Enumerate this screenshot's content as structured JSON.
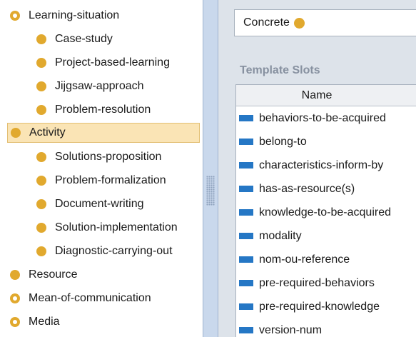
{
  "class_tree": {
    "items": [
      {
        "label": "Learning-situation",
        "level": 0,
        "icon": "ring-dot-icon"
      },
      {
        "label": "Case-study",
        "level": 1,
        "icon": "dot-icon"
      },
      {
        "label": "Project-based-learning",
        "level": 1,
        "icon": "dot-icon"
      },
      {
        "label": "Jijgsaw-approach",
        "level": 1,
        "icon": "dot-icon"
      },
      {
        "label": "Problem-resolution",
        "level": 1,
        "icon": "dot-icon"
      },
      {
        "label": "Activity",
        "level": 0,
        "icon": "dot-icon",
        "selected": true
      },
      {
        "label": "Solutions-proposition",
        "level": 1,
        "icon": "dot-icon"
      },
      {
        "label": "Problem-formalization",
        "level": 1,
        "icon": "dot-icon"
      },
      {
        "label": "Document-writing",
        "level": 1,
        "icon": "dot-icon"
      },
      {
        "label": "Solution-implementation",
        "level": 1,
        "icon": "dot-icon"
      },
      {
        "label": "Diagnostic-carrying-out",
        "level": 1,
        "icon": "dot-icon"
      },
      {
        "label": "Resource",
        "level": 0,
        "icon": "dot-icon"
      },
      {
        "label": "Mean-of-communication",
        "level": 0,
        "icon": "ring-dot-icon"
      },
      {
        "label": "Media",
        "level": 0,
        "icon": "ring-dot-icon"
      }
    ]
  },
  "class_field": {
    "value": "Concrete",
    "icon": "dot-icon"
  },
  "template_slots": {
    "title": "Template Slots",
    "column_header": "Name",
    "rows": [
      "behaviors-to-be-acquired",
      "belong-to",
      "characteristics-inform-by",
      "has-as-resource(s)",
      "knowledge-to-be-acquired",
      "modality",
      "nom-ou-reference",
      "pre-required-behaviors",
      "pre-required-knowledge",
      "version-num"
    ]
  },
  "colors": {
    "class_dot": "#e1a92e",
    "selection_bg": "#fae4b5",
    "slot_icon": "#2577c5",
    "splitter": "#c9d8ec",
    "right_panel_bg": "#dde3ea"
  }
}
